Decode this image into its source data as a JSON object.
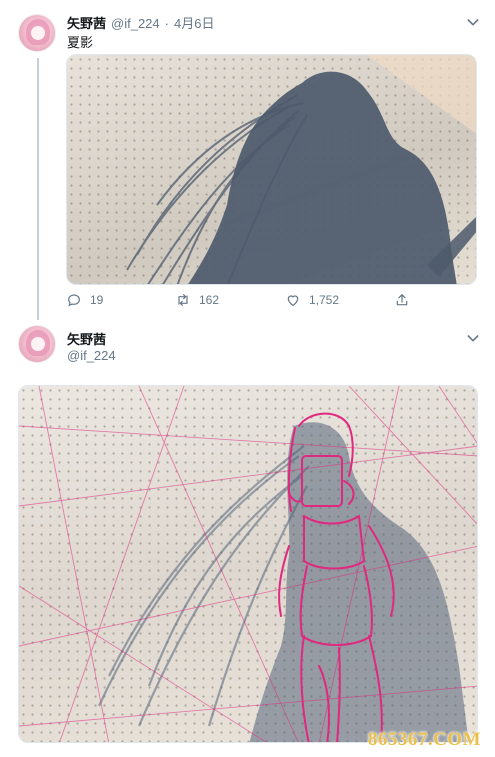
{
  "tweet1": {
    "display_name": "矢野茜",
    "handle": "@if_224",
    "separator": "·",
    "date": "4月6日",
    "text": "夏影",
    "actions": {
      "reply_count": "19",
      "retweet_count": "162",
      "like_count": "1,752"
    }
  },
  "tweet2": {
    "display_name": "矢野茜",
    "handle": "@if_224"
  },
  "watermark": "865367.COM",
  "colors": {
    "text": "#14171a",
    "muted": "#657786",
    "thread_line": "#c4cfd6",
    "sketch_pink": "#e0287f",
    "shadow": "#4f5c6e",
    "watermark": "#e9c04a"
  },
  "icons": [
    "chevron-down-icon",
    "reply-icon",
    "retweet-icon",
    "like-icon",
    "share-icon"
  ]
}
